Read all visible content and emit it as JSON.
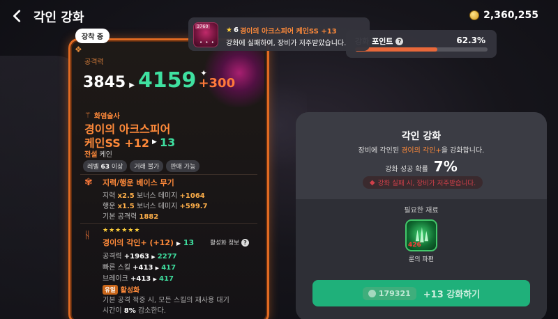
{
  "header": {
    "title": "각인 강화",
    "currency_amount": "2,360,255"
  },
  "card": {
    "equipped_tag": "장착 중",
    "stat_label": "공격력",
    "stat_old": "3845",
    "stat_new": "4159",
    "stat_bonus": "+300",
    "class_label": "화염술사",
    "item_name_line1": "경이의 아크스피어",
    "item_name_line2": "케인SS +12",
    "item_next_level": "13",
    "rarity": "전설",
    "rarity_type": "케인",
    "chips": {
      "level_prefix": "레벨",
      "level_num": "63",
      "level_suffix": "이상",
      "trade": "거래 불가",
      "sell": "판매 가능"
    },
    "weapon_type": "지력/행운 베이스 무기",
    "bonus1_prefix": "지력",
    "bonus1_mult": "x2.5",
    "bonus1_mid": "보너스 데미지",
    "bonus1_val": "+1064",
    "bonus2_prefix": "행운",
    "bonus2_mult": "x1.5",
    "bonus2_mid": "보너스 데미지",
    "bonus2_val": "+599.7",
    "base_label": "기본 공격력",
    "base_val": "1882",
    "rune_stars": "★★★★★★",
    "rune_name": "경이의 각인+ (+12)",
    "rune_next": "13",
    "activation_info": "활성화 정보",
    "rune_stat1_label": "공격력",
    "rune_stat1_old": "+1963",
    "rune_stat1_new": "2277",
    "rune_stat2_label": "빠른 스킬",
    "rune_stat2_old": "+413",
    "rune_stat2_new": "417",
    "rune_stat3_label": "브레이크",
    "rune_stat3_old": "+413",
    "rune_stat3_new": "417",
    "unique_badge": "유일",
    "unique_label": "활성화",
    "desc_line1": "기본 공격 적중 시, 모든 스킬의 재사용 대기",
    "desc_line2_pre": "시간이",
    "desc_line2_val": "8%",
    "desc_line2_post": "감소한다."
  },
  "toast": {
    "thumb_level": "3760",
    "thumb_dots": "• • •",
    "star_count": "6",
    "item_name": "경이의 아크스피어 케인SS +13",
    "message": "강화에 실패하여, 장비가 저주받았습니다."
  },
  "points": {
    "label": "강화 포인트",
    "percent_text": "62.3%",
    "fill_fraction": 0.623
  },
  "panel": {
    "title": "각인 강화",
    "desc_pre": "장비에 각인된",
    "desc_highlight": "경이의 각인+",
    "desc_post": "을 강화합니다.",
    "rate_label": "강화 성공 확률",
    "rate_value": "7%",
    "warning": "강화 실패 시, 장비가 저주받습니다.",
    "materials_label": "필요한 재료",
    "material_count": "426",
    "material_name": "룬의 파편",
    "cost": "179321",
    "button_label": "+13 강화하기"
  },
  "colors": {
    "accent_orange": "#ff8a3a",
    "accent_green": "#3fe0a0",
    "button_green": "#1fb07a",
    "warning_red": "#d0404a"
  },
  "icons": [
    "back-arrow-icon",
    "coin-icon",
    "star-icon",
    "help-icon",
    "warning-icon",
    "staff-icon",
    "rune-icon",
    "shard-icon"
  ]
}
